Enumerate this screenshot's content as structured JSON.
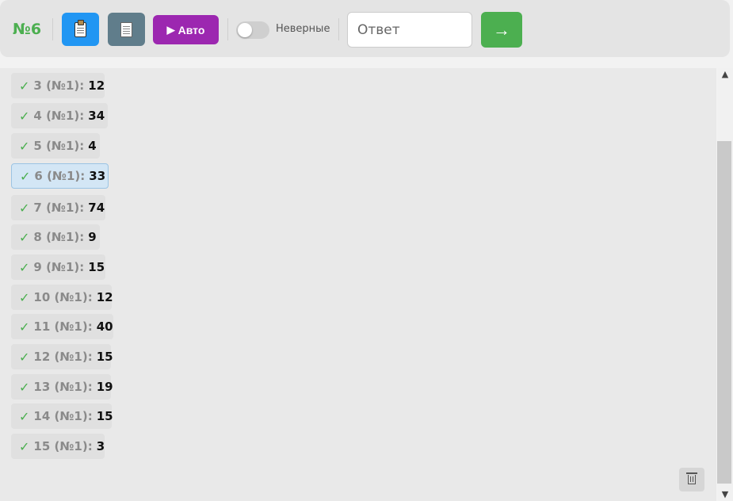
{
  "toolbar": {
    "counter": "№6",
    "auto_label": "Авто",
    "play_icon": "▶",
    "toggle_label": "Неверные",
    "toggle_on": false,
    "answer_placeholder": "Ответ",
    "answer_value": "",
    "submit_label": "→"
  },
  "icons": {
    "copy": "clipboard-icon",
    "document": "document-icon",
    "trash": "trash-icon"
  },
  "colors": {
    "accent_green": "#4caf50",
    "copy_blue": "#2196f3",
    "doc_gray": "#607d8b",
    "auto_purple": "#9c27b0"
  },
  "history": {
    "check_mark": "✓",
    "items": [
      {
        "label": "3 (№1):",
        "value": "12",
        "active": false
      },
      {
        "label": "4 (№1):",
        "value": "34",
        "active": false
      },
      {
        "label": "5 (№1):",
        "value": "4",
        "active": false
      },
      {
        "label": "6 (№1):",
        "value": "33",
        "active": true
      },
      {
        "label": "7 (№1):",
        "value": "74",
        "active": false
      },
      {
        "label": "8 (№1):",
        "value": "9",
        "active": false
      },
      {
        "label": "9 (№1):",
        "value": "15",
        "active": false
      },
      {
        "label": "10 (№1):",
        "value": "12",
        "active": false
      },
      {
        "label": "11 (№1):",
        "value": "40",
        "active": false
      },
      {
        "label": "12 (№1):",
        "value": "15",
        "active": false
      },
      {
        "label": "13 (№1):",
        "value": "19",
        "active": false
      },
      {
        "label": "14 (№1):",
        "value": "15",
        "active": false
      },
      {
        "label": "15 (№1):",
        "value": "3",
        "active": false
      }
    ]
  },
  "scrollbar": {
    "up_arrow": "▲",
    "down_arrow": "▼"
  }
}
